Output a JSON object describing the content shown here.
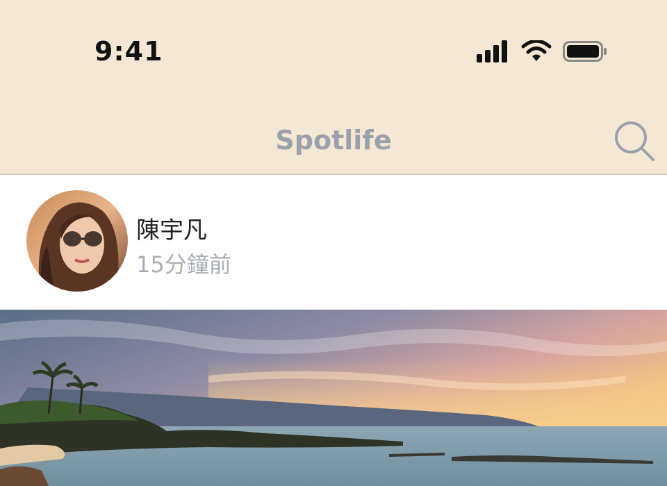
{
  "status_bar": {
    "time": "9:41",
    "icons": [
      "signal-icon",
      "wifi-icon",
      "battery-icon"
    ]
  },
  "navbar": {
    "title": "Spotlife",
    "search_icon": "search-icon"
  },
  "post": {
    "author_name": "陳宇凡",
    "time_ago": "15分鐘前",
    "avatar": "avatar-photo",
    "image": "beach-sunset-photo"
  },
  "colors": {
    "header_bg": "#f4e7d4",
    "title_gray": "#9aa1aa",
    "meta_gray": "#a9aeb5"
  }
}
